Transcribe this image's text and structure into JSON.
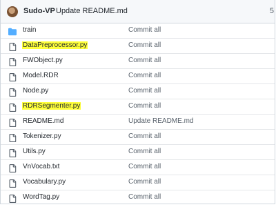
{
  "header": {
    "author": "Sudo-VP",
    "message": "Update README.md",
    "right_text": "5"
  },
  "colors": {
    "folder": "#54aeff",
    "file_icon": "#57606a",
    "highlight": "#ffff3a",
    "header_bg": "#f6f8fa"
  },
  "files": [
    {
      "name": "train",
      "type": "folder",
      "icon": "folder-icon",
      "message": "Commit all",
      "highlighted": false
    },
    {
      "name": "DataPreprocessor.py",
      "type": "file",
      "icon": "file-icon",
      "message": "Commit all",
      "highlighted": true
    },
    {
      "name": "FWObject.py",
      "type": "file",
      "icon": "file-icon",
      "message": "Commit all",
      "highlighted": false
    },
    {
      "name": "Model.RDR",
      "type": "file",
      "icon": "file-icon",
      "message": "Commit all",
      "highlighted": false
    },
    {
      "name": "Node.py",
      "type": "file",
      "icon": "file-icon",
      "message": "Commit all",
      "highlighted": false
    },
    {
      "name": "RDRSegmenter.py",
      "type": "file",
      "icon": "file-icon",
      "message": "Commit all",
      "highlighted": true
    },
    {
      "name": "README.md",
      "type": "file",
      "icon": "file-icon",
      "message": "Update README.md",
      "highlighted": false
    },
    {
      "name": "Tokenizer.py",
      "type": "file",
      "icon": "file-icon",
      "message": "Commit all",
      "highlighted": false
    },
    {
      "name": "Utils.py",
      "type": "file",
      "icon": "file-icon",
      "message": "Commit all",
      "highlighted": false
    },
    {
      "name": "VnVocab.txt",
      "type": "file",
      "icon": "file-icon",
      "message": "Commit all",
      "highlighted": false
    },
    {
      "name": "Vocabulary.py",
      "type": "file",
      "icon": "file-icon",
      "message": "Commit all",
      "highlighted": false
    },
    {
      "name": "WordTag.py",
      "type": "file",
      "icon": "file-icon",
      "message": "Commit all",
      "highlighted": false
    }
  ]
}
